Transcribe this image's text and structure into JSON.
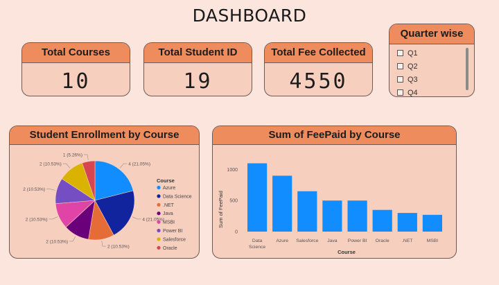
{
  "page": {
    "title": "DASHBOARD"
  },
  "kpis": {
    "total_courses": {
      "label": "Total Courses",
      "value": "10"
    },
    "total_student_id": {
      "label": "Total Student ID",
      "value": "19"
    },
    "total_fee": {
      "label": "Total Fee Collected",
      "value": "4550"
    }
  },
  "slicer": {
    "title": "Quarter wise",
    "items": [
      "Q1",
      "Q2",
      "Q3",
      "Q4"
    ]
  },
  "pie": {
    "title": "Student Enrollment by Course",
    "legend_title": "Course"
  },
  "bar": {
    "title": "Sum of FeePaid by Course"
  },
  "chart_data": [
    {
      "type": "pie",
      "title": "Student Enrollment by Course",
      "legend_title": "Course",
      "legend_position": "right",
      "categories": [
        "Azure",
        "Data Science",
        ".NET",
        "Java",
        "MSBI",
        "Power BI",
        "Salesforce",
        "Oracle"
      ],
      "values": [
        4,
        4,
        2,
        2,
        2,
        2,
        2,
        1
      ],
      "labels": [
        "4 (21.05%)",
        "4 (21.05%)",
        "2 (10.53%)",
        "2 (10.53%)",
        "2 (10.53%)",
        "2 (10.53%)",
        "2 (10.53%)",
        "1 (5.26%)"
      ],
      "colors": [
        "#118dff",
        "#12239e",
        "#e66c37",
        "#6b007b",
        "#e044a7",
        "#744ec2",
        "#d9b300",
        "#d64550"
      ]
    },
    {
      "type": "bar",
      "title": "Sum of FeePaid by Course",
      "xlabel": "Course",
      "ylabel": "Sum of FeePaid",
      "categories": [
        "Data Science",
        "Azure",
        "Salesforce",
        "Java",
        "Power BI",
        "Oracle",
        ".NET",
        "MSBI"
      ],
      "values": [
        1100,
        900,
        650,
        500,
        500,
        350,
        300,
        270
      ],
      "yticks": [
        0,
        500,
        1000
      ],
      "ylim": [
        0,
        1150
      ],
      "grid": false,
      "color": "#118dff"
    }
  ]
}
